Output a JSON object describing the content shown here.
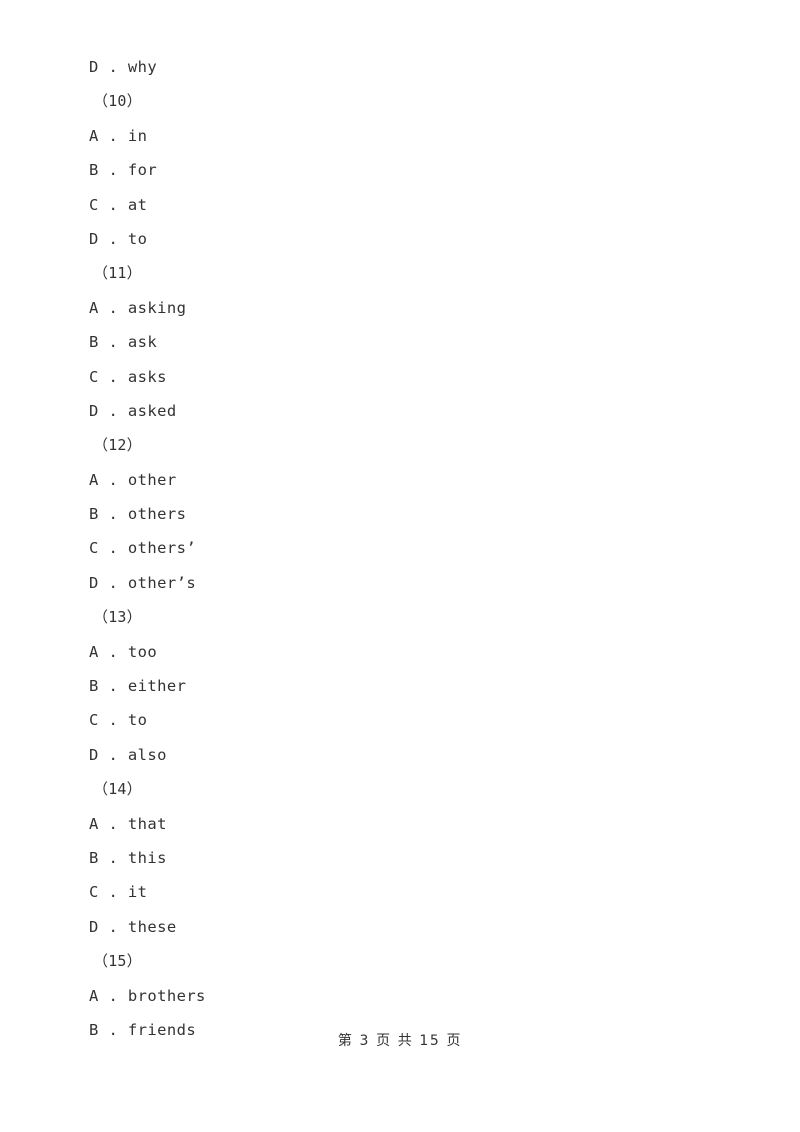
{
  "document": {
    "page_number": 3,
    "total_pages": 15,
    "footer_text": "第 3 页 共 15 页"
  },
  "lines": [
    {
      "kind": "option",
      "text": "D . why"
    },
    {
      "kind": "question",
      "text": "（10）"
    },
    {
      "kind": "option",
      "text": "A . in"
    },
    {
      "kind": "option",
      "text": "B . for"
    },
    {
      "kind": "option",
      "text": "C . at"
    },
    {
      "kind": "option",
      "text": "D . to"
    },
    {
      "kind": "question",
      "text": "（11）"
    },
    {
      "kind": "option",
      "text": "A . asking"
    },
    {
      "kind": "option",
      "text": "B . ask"
    },
    {
      "kind": "option",
      "text": "C . asks"
    },
    {
      "kind": "option",
      "text": "D . asked"
    },
    {
      "kind": "question",
      "text": "（12）"
    },
    {
      "kind": "option",
      "text": "A . other"
    },
    {
      "kind": "option",
      "text": "B . others"
    },
    {
      "kind": "option",
      "text": "C . others’"
    },
    {
      "kind": "option",
      "text": "D . other’s"
    },
    {
      "kind": "question",
      "text": "（13）"
    },
    {
      "kind": "option",
      "text": "A . too"
    },
    {
      "kind": "option",
      "text": "B . either"
    },
    {
      "kind": "option",
      "text": "C . to"
    },
    {
      "kind": "option",
      "text": "D . also"
    },
    {
      "kind": "question",
      "text": "（14）"
    },
    {
      "kind": "option",
      "text": "A . that"
    },
    {
      "kind": "option",
      "text": "B . this"
    },
    {
      "kind": "option",
      "text": "C . it"
    },
    {
      "kind": "option",
      "text": "D . these"
    },
    {
      "kind": "question",
      "text": "（15）"
    },
    {
      "kind": "option",
      "text": "A . brothers"
    },
    {
      "kind": "option",
      "text": "B . friends"
    }
  ]
}
